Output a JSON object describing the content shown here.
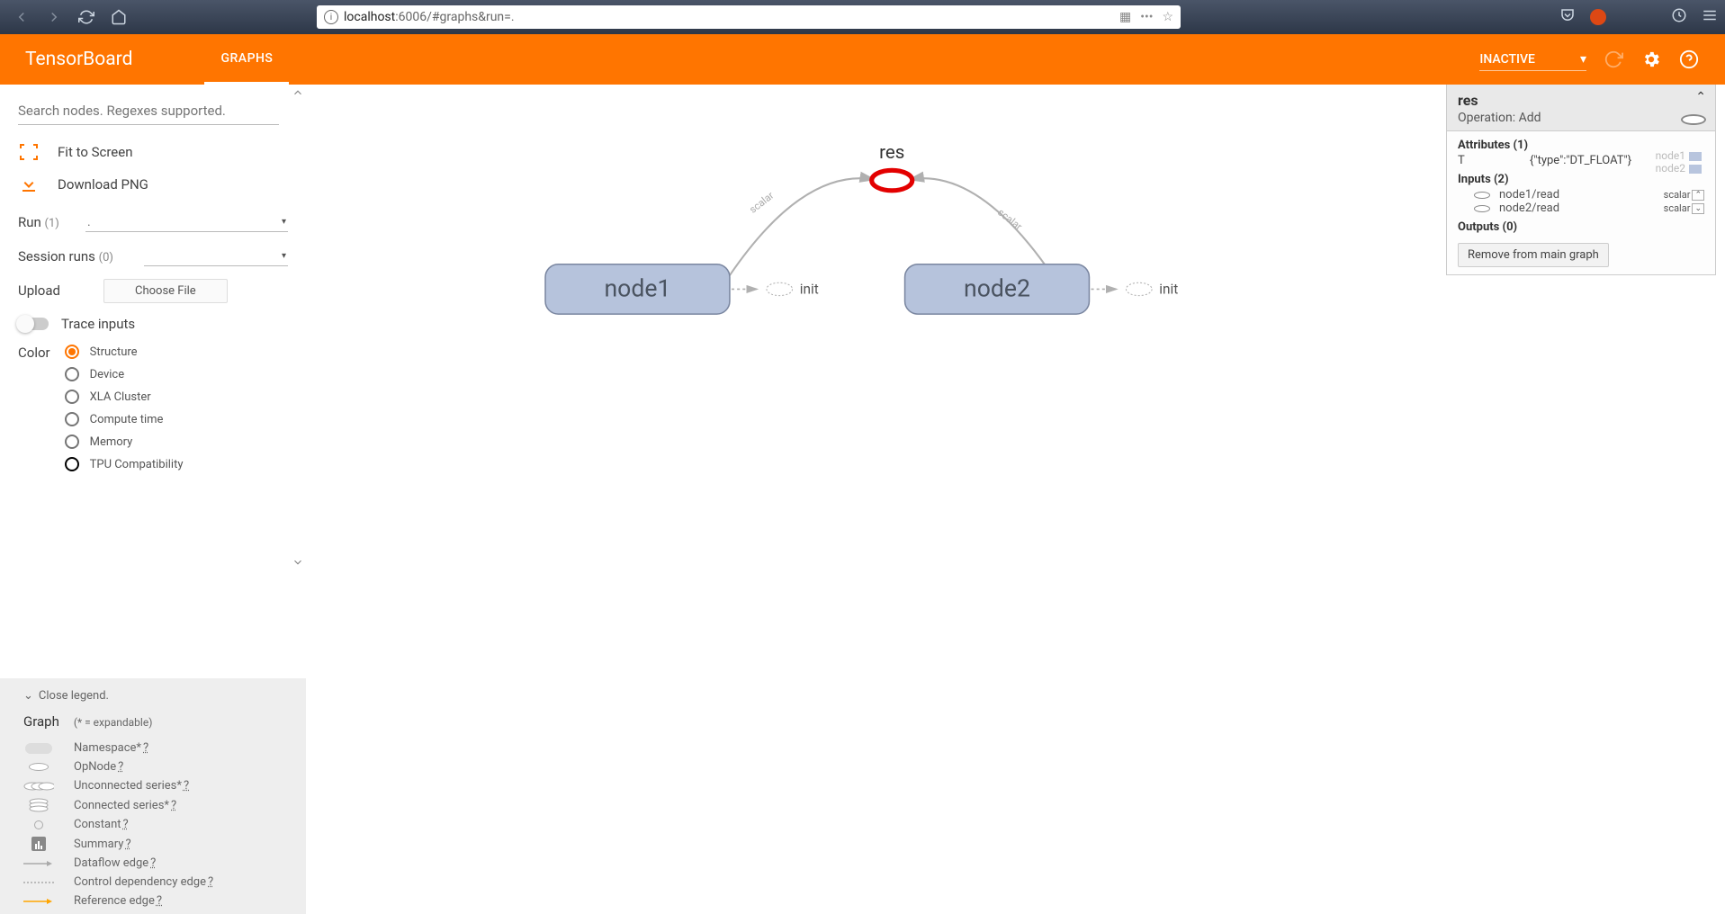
{
  "browser": {
    "url_host": "localhost",
    "url_path": ":6006/#graphs&run=."
  },
  "header": {
    "logo": "TensorBoard",
    "tab": "GRAPHS",
    "inactive": "INACTIVE"
  },
  "sidebar": {
    "search_placeholder": "Search nodes. Regexes supported.",
    "fit": "Fit to Screen",
    "download": "Download PNG",
    "run_label": "Run",
    "run_count": "(1)",
    "run_value": ".",
    "sess_label": "Session runs",
    "sess_count": "(0)",
    "upload_label": "Upload",
    "choose_file": "Choose File",
    "trace": "Trace inputs",
    "color_label": "Color",
    "colors": {
      "structure": "Structure",
      "device": "Device",
      "xla": "XLA Cluster",
      "compute": "Compute time",
      "memory": "Memory",
      "tpu": "TPU Compatibility"
    }
  },
  "legend": {
    "close": "Close legend.",
    "graph": "Graph",
    "hint": "(* = expandable)",
    "namespace": "Namespace*",
    "opnode": "OpNode",
    "unconn": "Unconnected series*",
    "conn": "Connected series*",
    "constant": "Constant",
    "summary": "Summary",
    "dataflow": "Dataflow edge",
    "control": "Control dependency edge",
    "reference": "Reference edge",
    "q": "?"
  },
  "graph": {
    "res": "res",
    "node1": "node1",
    "node2": "node2",
    "init1": "init",
    "init2": "init",
    "scalar": "scalar"
  },
  "info": {
    "name": "res",
    "op_label": "Operation: ",
    "op": "Add",
    "attrs_h": "Attributes (1)",
    "attr_k": "T",
    "attr_v": "{\"type\":\"DT_FLOAT\"}",
    "inputs_h": "Inputs (2)",
    "in1": "node1/read",
    "in2": "node2/read",
    "scalar": "scalar",
    "outputs_h": "Outputs (0)",
    "remove": "Remove from main graph",
    "ghost1": "node1",
    "ghost2": "node2"
  }
}
